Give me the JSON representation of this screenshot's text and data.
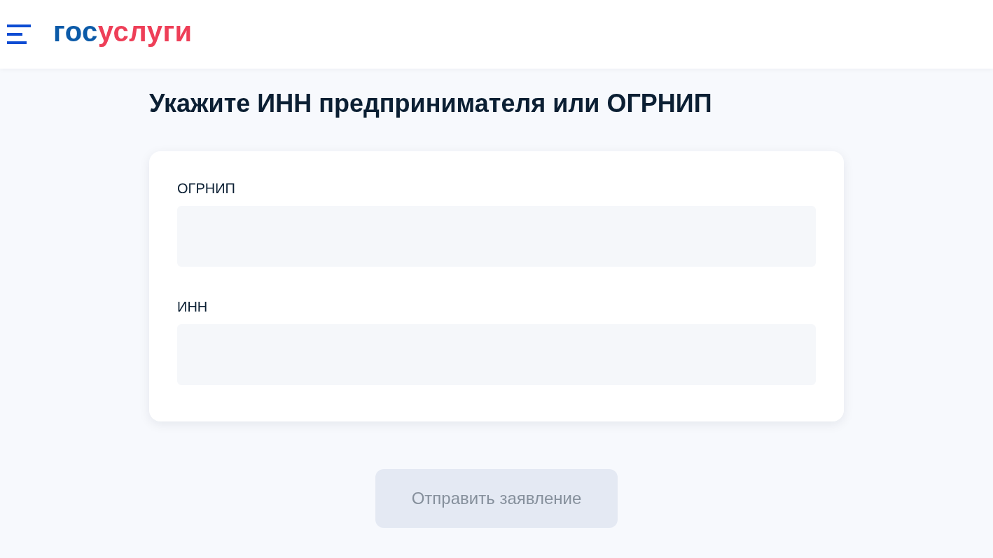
{
  "header": {
    "logo": [
      {
        "text": "гос",
        "color": "#0b5aa8"
      },
      {
        "text": "услуги",
        "color": "#ee3f58"
      }
    ]
  },
  "title": "Укажите ИНН предпринимателя или ОГРНИП",
  "fields": [
    {
      "label": "ОГРНИП"
    },
    {
      "label": "ИНН"
    }
  ],
  "submit": {
    "label": "Отправить заявление",
    "disabled": true
  }
}
